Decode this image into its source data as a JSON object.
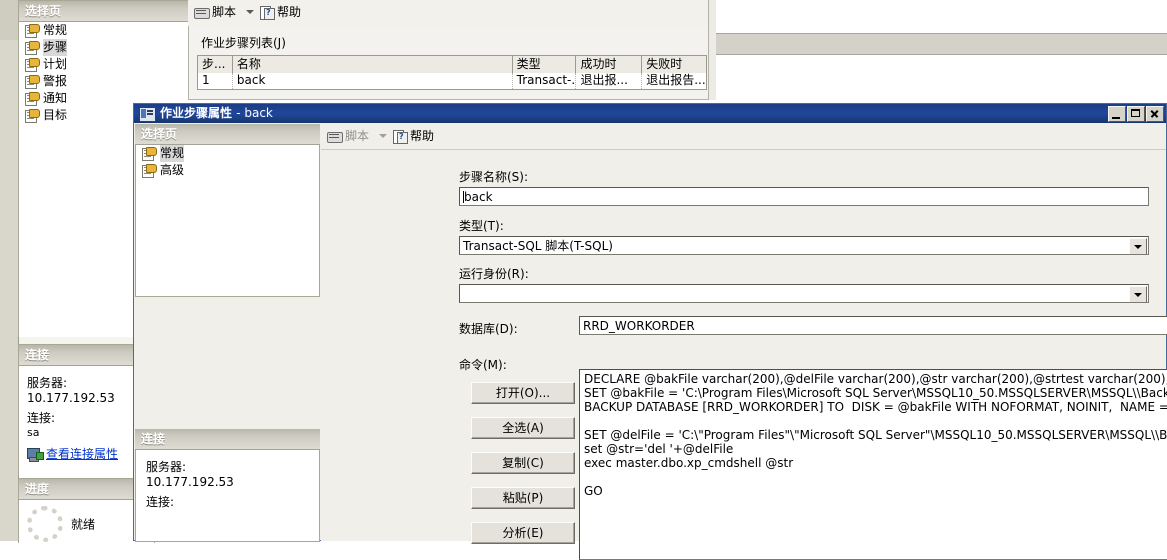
{
  "background_window": {
    "selection_page": {
      "header": "选择页",
      "items": [
        {
          "label": "常规",
          "selected": false
        },
        {
          "label": "步骤",
          "selected": true
        },
        {
          "label": "计划",
          "selected": false
        },
        {
          "label": "警报",
          "selected": false
        },
        {
          "label": "通知",
          "selected": false
        },
        {
          "label": "目标",
          "selected": false
        }
      ]
    },
    "connection": {
      "header": "连接",
      "server_label": "服务器:",
      "server_value": "10.177.192.53",
      "connection_label": "连接:",
      "connection_value": "sa",
      "link": "查看连接属性",
      "link_icon": "connection-properties-icon"
    },
    "progress": {
      "header": "进度",
      "status": "就绪",
      "spinner_icon": "progress-spinner-icon"
    },
    "toolbar": {
      "script_label": "脚本",
      "script_icon": "script-icon",
      "dropdown_icon": "chevron-down-icon",
      "help_label": "帮助",
      "help_icon": "help-icon"
    },
    "steps_grid": {
      "caption": "作业步骤列表(J)",
      "columns": [
        "步...",
        "名称",
        "类型",
        "成功时",
        "失败时"
      ],
      "rows": [
        {
          "step": "1",
          "name": "back",
          "type": "Transact-...",
          "on_success": "退出报...",
          "on_failure": "退出报告..."
        }
      ]
    }
  },
  "dialog": {
    "title": "作业步骤属性",
    "title_sub": "- back",
    "title_icon": "job-step-properties-icon",
    "window_buttons": {
      "minimize": "minimize-button",
      "maximize": "maximize-button",
      "close": "close-button"
    },
    "selection_page": {
      "header": "选择页",
      "items": [
        {
          "label": "常规",
          "selected": true
        },
        {
          "label": "高级",
          "selected": false
        }
      ]
    },
    "connection": {
      "header": "连接",
      "server_label": "服务器:",
      "server_value": "10.177.192.53",
      "connection_label": "连接:"
    },
    "toolbar": {
      "script_label": "脚本",
      "script_icon": "script-icon",
      "dropdown_icon": "chevron-down-icon",
      "help_label": "帮助",
      "help_icon": "help-icon"
    },
    "form": {
      "step_name_label": "步骤名称(S):",
      "step_name_value": "back",
      "type_label": "类型(T):",
      "type_value": "Transact-SQL 脚本(T-SQL)",
      "run_as_label": "运行身份(R):",
      "run_as_value": "",
      "database_label": "数据库(D):",
      "database_value": "RRD_WORKORDER",
      "command_label": "命令(M):",
      "command_value": "DECLARE @bakFile varchar(200),@delFile varchar(200),@str varchar(200),@strtest varchar(200);\nSET @bakFile = 'C:\\Program Files\\Microsoft SQL Server\\MSSQL10_50.MSSQLSERVER\\MSSQL\\\\Backup\\\\RRD_WORKORDER\\PMT_W\nBACKUP DATABASE [RRD_WORKORDER] TO  DISK = @bakFile WITH NOFORMAT, NOINIT,  NAME = N'RRD_WORKORDER-完整 数\n\nSET @delFile = 'C:\\\"Program Files\"\\\"Microsoft SQL Server\"\\MSSQL10_50.MSSQLSERVER\\MSSQL\\\\Backup\\RRD_WORKORDER\\PMT_\nset @str='del '+@delFile\nexec master.dbo.xp_cmdshell @str\n\nGO",
      "buttons": [
        {
          "label": "打开(O)...",
          "name": "open-button"
        },
        {
          "label": "全选(A)",
          "name": "select-all-button"
        },
        {
          "label": "复制(C)",
          "name": "copy-button"
        },
        {
          "label": "粘贴(P)",
          "name": "paste-button"
        },
        {
          "label": "分析(E)",
          "name": "parse-button"
        }
      ]
    }
  }
}
